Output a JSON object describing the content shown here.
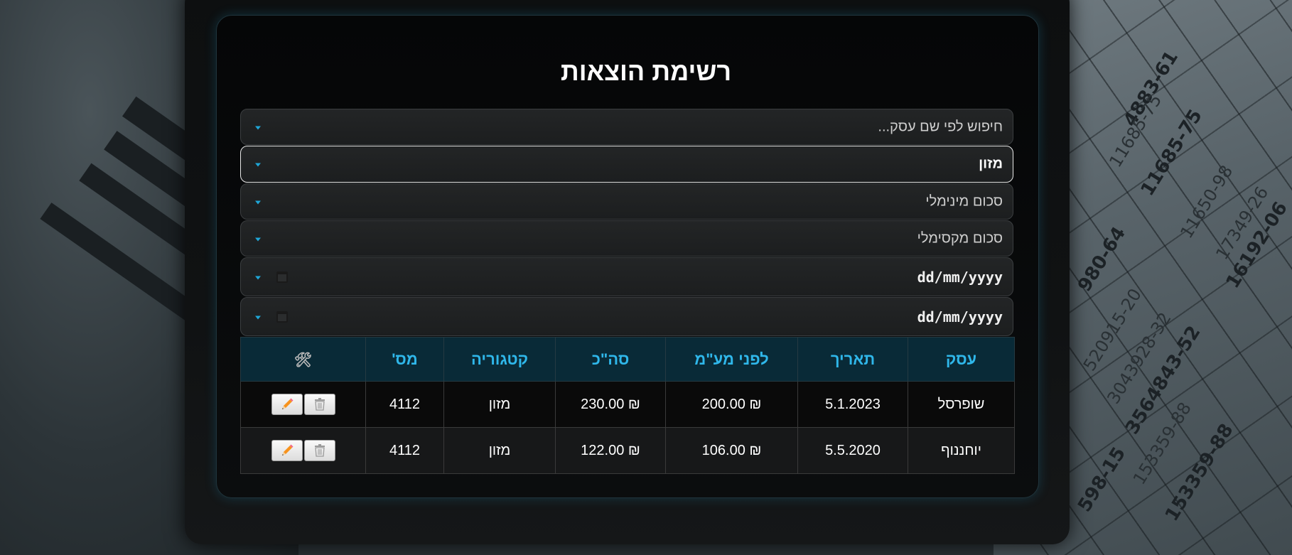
{
  "page": {
    "title": "רשימת הוצאות"
  },
  "filters": {
    "search_placeholder": "חיפוש לפי שם עסק...",
    "category_selected": "מזון",
    "min_amount_placeholder": "סכום מינימלי",
    "max_amount_placeholder": "סכום מקסימלי",
    "date_from_placeholder": "dd/mm/yyyy",
    "date_to_placeholder": "dd/mm/yyyy"
  },
  "table": {
    "headers": {
      "business": "עסק",
      "date": "תאריך",
      "before_vat": "לפני מע\"מ",
      "total": "סה\"כ",
      "category": "קטגוריה",
      "number": "מס'",
      "actions_icon": "🛠"
    },
    "rows": [
      {
        "business": "שופרסל",
        "date": "5.1.2023",
        "before_vat": "₪ 200.00",
        "total": "₪ 230.00",
        "category": "מזון",
        "number": "4112"
      },
      {
        "business": "יוחננוף",
        "date": "5.5.2020",
        "before_vat": "₪ 106.00",
        "total": "₪ 122.00",
        "category": "מזון",
        "number": "4112"
      }
    ]
  },
  "icons": {
    "edit": "pencil-icon",
    "delete": "trash-icon",
    "calendar": "calendar-icon",
    "dropdown": "caret-down-icon",
    "actions": "tools-icon"
  },
  "colors": {
    "accent": "#2fb7ea",
    "header_bg": "#092a37",
    "card_bg": "#050607"
  }
}
